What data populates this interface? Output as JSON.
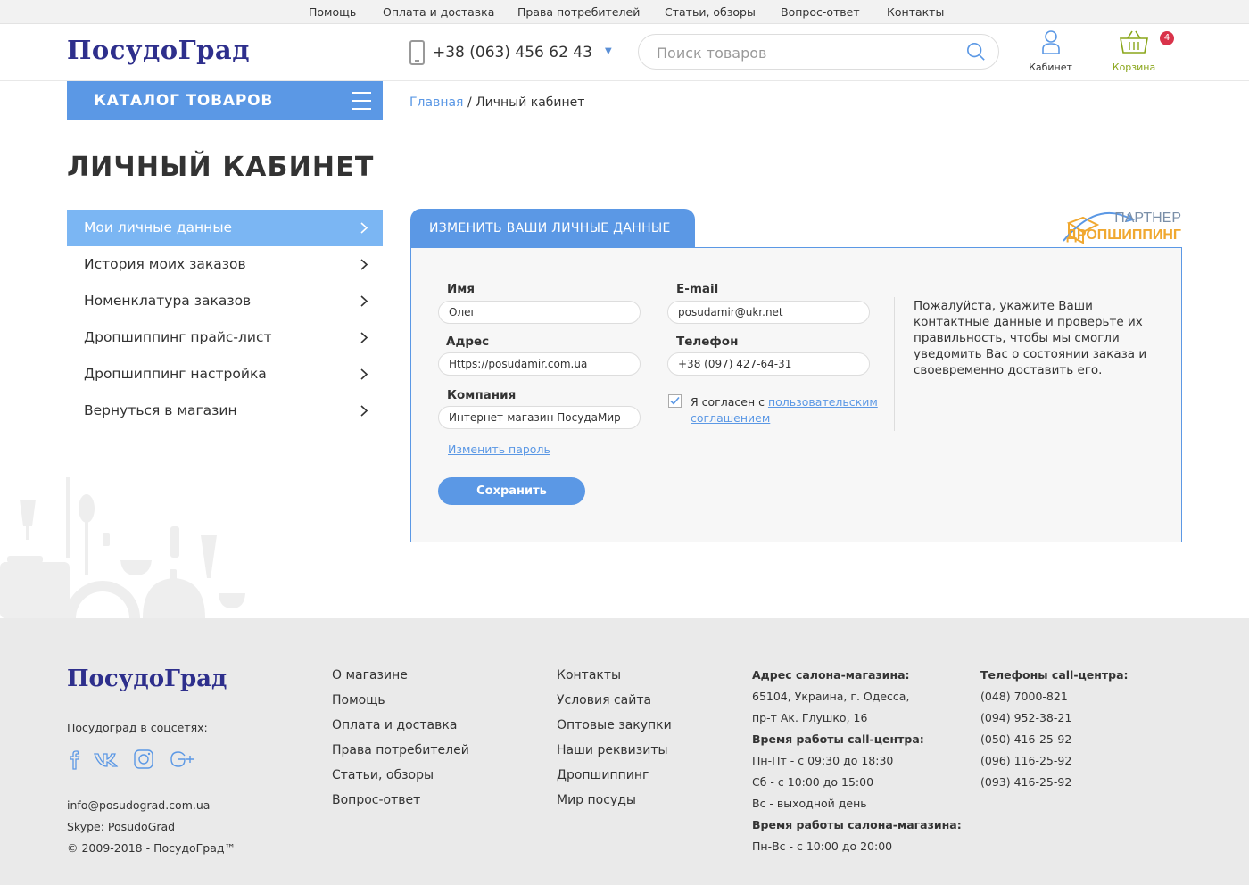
{
  "topnav": [
    "Помощь",
    "Оплата и доставка",
    "Права потребителей",
    "Статьи, обзоры",
    "Вопрос-ответ",
    "Контакты"
  ],
  "header": {
    "logo": "ПосудоГрад",
    "phone": "+38 (063) 456 62 43",
    "search_placeholder": "Поиск товаров",
    "cabinet_label": "Кабинет",
    "cart_label": "Корзина",
    "cart_count": "4"
  },
  "catalog_label": "КАТАЛОГ ТОВАРОВ",
  "breadcrumb": {
    "home": "Главная",
    "sep": "/",
    "current": "Личный кабинет"
  },
  "page_title": "ЛИЧНЫЙ КАБИНЕТ",
  "menu": [
    "Мои личные данные",
    "История моих заказов",
    "Номенклатура заказов",
    "Дропшиппинг прайс-лист",
    "Дропшиппинг настройка",
    "Вернуться в магазин"
  ],
  "form": {
    "tab": "ИЗМЕНИТЬ ВАШИ ЛИЧНЫЕ ДАННЫЕ",
    "partner_line1": "ПАРТНЕР",
    "partner_line2": "ДРОПШИППИНГ",
    "name_label": "Имя",
    "name_value": "Олег",
    "address_label": "Адрес",
    "address_value": "Https://posudamir.com.ua",
    "company_label": "Компания",
    "company_value": "Интернет-магазин ПосудаМир",
    "email_label": "E-mail",
    "email_value": "posudamir@ukr.net",
    "phone_label": "Телефон",
    "phone_value": "+38 (097) 427-64-31",
    "agree_text": "Я согласен с ",
    "agree_link": "пользовательским соглашением",
    "change_password": "Изменить пароль",
    "save": "Сохранить",
    "info": "Пожалуйста, укажите Ваши контактные данные и проверьте их правильность, чтобы мы смогли уведомить Вас о состоянии заказа и своевременно доставить его."
  },
  "footer": {
    "logo": "ПосудоГрад",
    "social_title": "Посудоград в соцсетях:",
    "email": "info@posudograd.com.ua",
    "skype": "Skype: PosudoGrad",
    "copyright": "© 2009-2018 - ПосудоГрад™",
    "col1": [
      "О магазине",
      "Помощь",
      "Оплата и доставка",
      "Права потребителей",
      "Статьи, обзоры",
      "Вопрос-ответ"
    ],
    "col2": [
      "Контакты",
      "Условия сайта",
      "Оптовые закупки",
      "Наши реквизиты",
      "Дропшиппинг",
      "Мир посуды"
    ],
    "address": [
      "Адрес салона-магазина:",
      "65104, Украина, г. Одесса,",
      "пр-т Ак. Глушко, 16",
      "Время работы call-центра:",
      "Пн-Пт - с 09:30 до 18:30",
      "Сб - с 10:00 до 15:00",
      "Вс - выходной день",
      "Время работы салона-магазина:",
      "Пн-Вс - с 10:00 до 20:00"
    ],
    "phones_title": "Телефоны call-центра:",
    "phones": [
      "(048) 7000-821",
      "(094) 952-38-21",
      "(050) 416-25-92",
      "(096) 116-25-92",
      "(093) 416-25-92"
    ]
  },
  "colors": {
    "accent": "#5b98e5",
    "active_menu": "#7bb6f3",
    "logo": "#2e2f8c",
    "cart": "#8aa61a",
    "badge": "#d9334a"
  }
}
